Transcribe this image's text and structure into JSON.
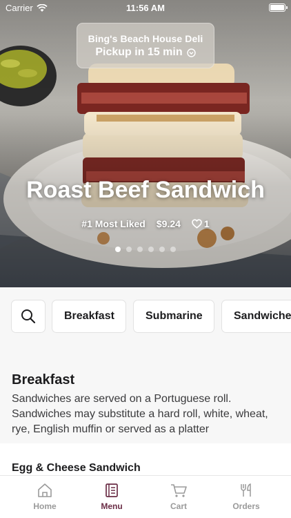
{
  "status": {
    "carrier": "Carrier",
    "time": "11:56 AM"
  },
  "pickup": {
    "store": "Bing's Beach House Deli",
    "eta": "Pickup in 15 min"
  },
  "hero": {
    "title": "Roast Beef Sandwich",
    "rank": "#1 Most Liked",
    "price": "$9.24",
    "likes": "1",
    "slides": 6,
    "active_slide": 1
  },
  "categories": [
    "Breakfast",
    "Submarine",
    "Sandwiches"
  ],
  "section": {
    "title": "Breakfast",
    "description": "Sandwiches are served on a Portuguese roll. Sandwiches may substitute a hard roll, white, wheat, rye, English muffin or served as a platter"
  },
  "item": {
    "name": "Egg & Cheese Sandwich"
  },
  "tabs": [
    {
      "label": "Home",
      "icon": "home-icon"
    },
    {
      "label": "Menu",
      "icon": "menu-icon"
    },
    {
      "label": "Cart",
      "icon": "cart-icon"
    },
    {
      "label": "Orders",
      "icon": "orders-icon"
    }
  ],
  "colors": {
    "accent": "#6a2c45",
    "inactive": "#9a9a9a"
  }
}
